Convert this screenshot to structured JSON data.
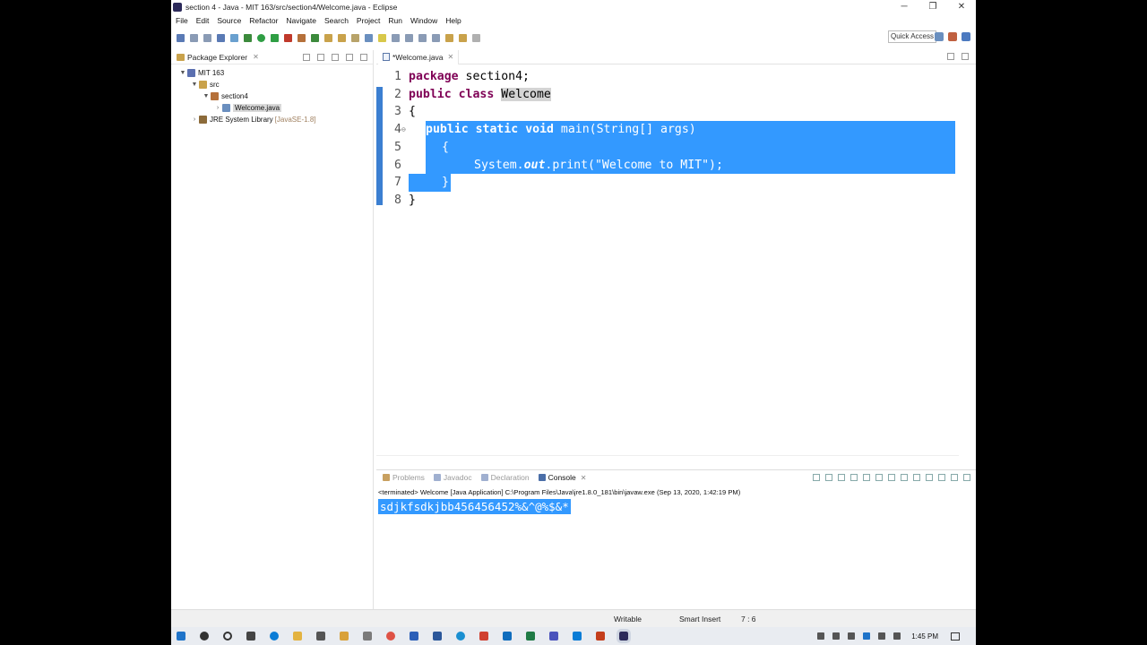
{
  "window": {
    "title": "section 4 - Java - MIT 163/src/section4/Welcome.java - Eclipse",
    "minimize": "─",
    "restore": "❐",
    "close": "✕"
  },
  "menu": [
    "File",
    "Edit",
    "Source",
    "Refactor",
    "Navigate",
    "Search",
    "Project",
    "Run",
    "Window",
    "Help"
  ],
  "toolbar": {
    "quick_access": "Quick Access"
  },
  "package_explorer": {
    "tab_label": "Package Explorer",
    "tree": [
      {
        "label": "MIT 163",
        "arrow": "▼",
        "icon_color": "#5b6fb0",
        "indent": 0
      },
      {
        "label": "src",
        "arrow": "▼",
        "icon_color": "#c9a24b",
        "indent": 1
      },
      {
        "label": "section4",
        "arrow": "▼",
        "icon_color": "#b5703a",
        "indent": 2
      },
      {
        "label": "Welcome.java",
        "arrow": "›",
        "icon_color": "#6a8fbf",
        "indent": 3,
        "selected": true
      },
      {
        "label": "JRE System Library",
        "decor": "[JavaSE-1.8]",
        "arrow": "›",
        "icon_color": "#8c6b3a",
        "indent": 1
      }
    ]
  },
  "editor": {
    "tab_label": "*Welcome.java",
    "lines": [
      {
        "num": "1",
        "text": "package section4;"
      },
      {
        "num": "2",
        "text": "public class Welcome"
      },
      {
        "num": "3",
        "text": "{"
      },
      {
        "num": "4",
        "text": "public static void main(String[] args)"
      },
      {
        "num": "5",
        "text": "{"
      },
      {
        "num": "6",
        "text": "System.out.print(\"Welcome to MIT\");"
      },
      {
        "num": "7",
        "text": "}"
      },
      {
        "num": "8",
        "text": "}"
      }
    ]
  },
  "console": {
    "tabs": [
      "Problems",
      "Javadoc",
      "Declaration",
      "Console"
    ],
    "active_tab": "Console",
    "status": "<terminated> Welcome [Java Application] C:\\Program Files\\Java\\jre1.8.0_181\\bin\\javaw.exe (Sep 13, 2020, 1:42:19 PM)",
    "output": "sdjkfsdkjbb456456452%&^@%$&*"
  },
  "statusbar": {
    "writable": "Writable",
    "insert_mode": "Smart Insert",
    "position": "7 : 6"
  },
  "taskbar": {
    "clock": "1:45 PM"
  },
  "colors": {
    "selection": "#3399ff",
    "keyword": "#7f0055",
    "string": "#2a00ff"
  }
}
